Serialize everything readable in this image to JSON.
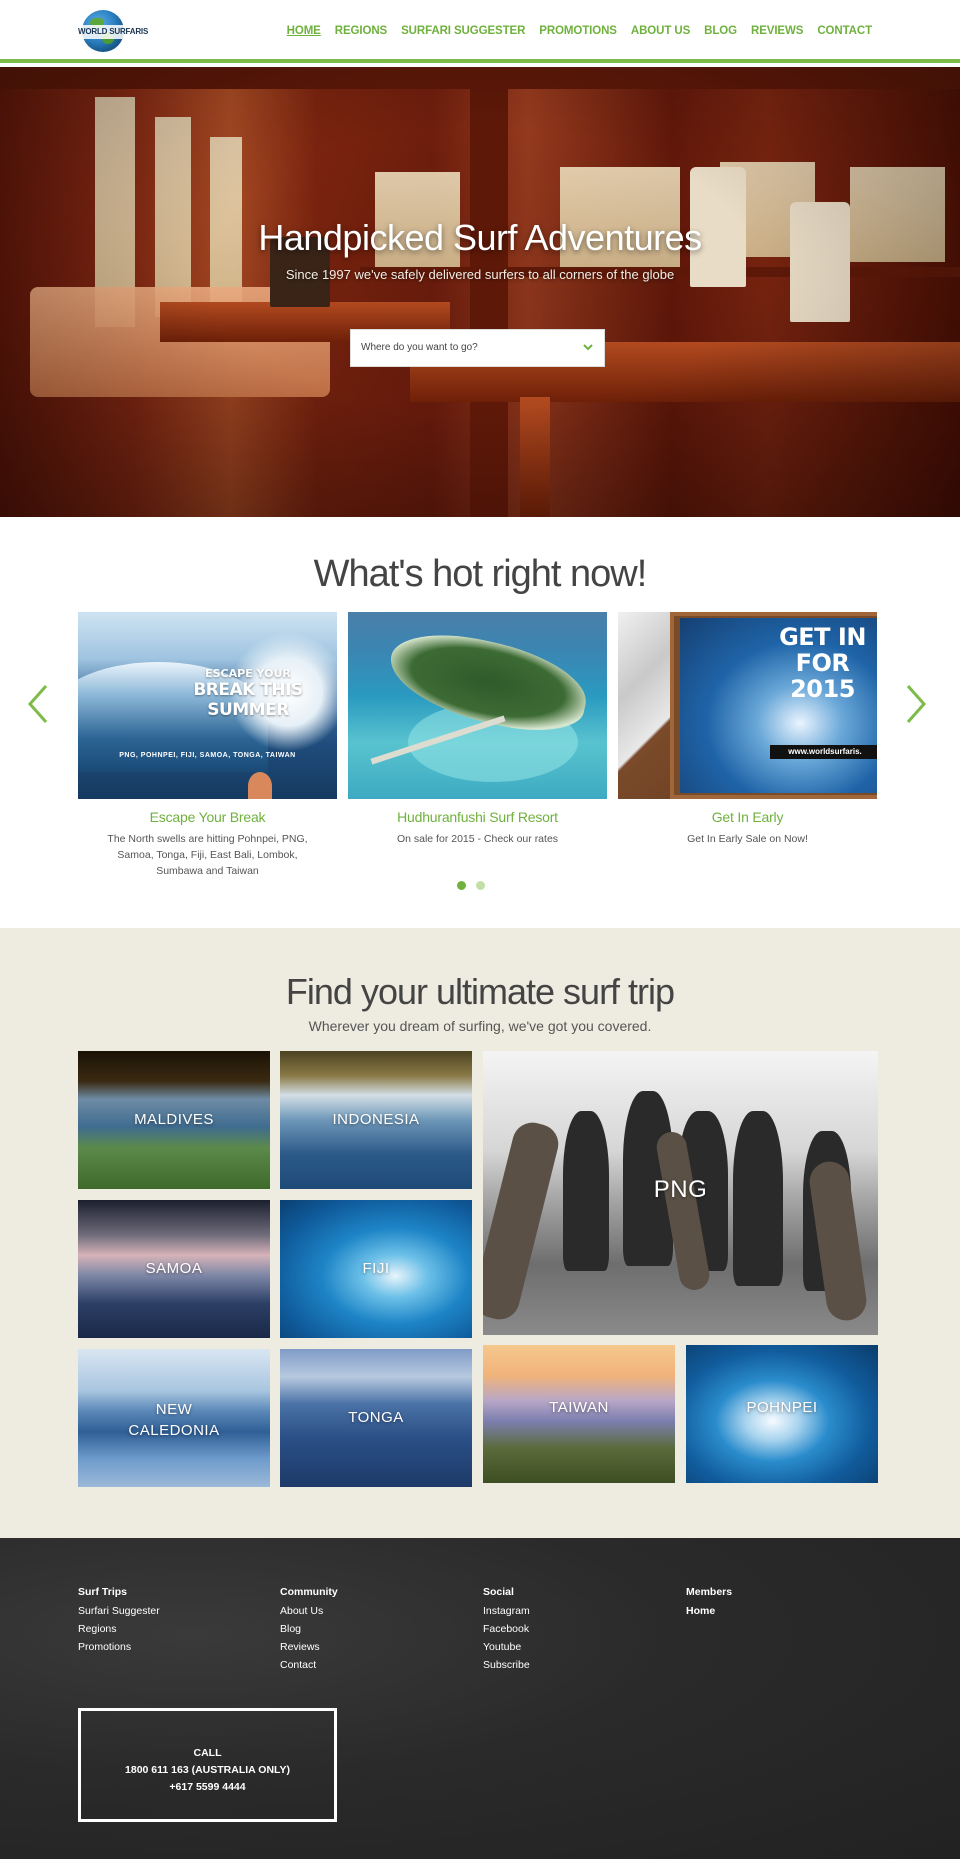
{
  "header": {
    "logo_text": "WORLD SURFARIS",
    "nav": [
      {
        "label": "HOME",
        "active": true
      },
      {
        "label": "REGIONS"
      },
      {
        "label": "SURFARI SUGGESTER"
      },
      {
        "label": "PROMOTIONS"
      },
      {
        "label": "ABOUT US"
      },
      {
        "label": "BLOG"
      },
      {
        "label": "REVIEWS"
      },
      {
        "label": "CONTACT"
      }
    ]
  },
  "hero": {
    "title": "Handpicked Surf Adventures",
    "subtitle": "Since 1997 we've safely delivered surfers to all corners of the globe",
    "select_placeholder": "Where do you want to go?"
  },
  "hot": {
    "title": "What's hot right now!",
    "cards": [
      {
        "title": "Escape Your Break",
        "desc": "The North swells are hitting Pohnpei, PNG, Samoa, Tonga, Fiji, East Bali, Lombok, Sumbawa and Taiwan",
        "image_line1": "ESCAPE YOUR",
        "image_line2": "BREAK THIS",
        "image_line3": "SUMMER",
        "image_caption": "PNG, POHNPEI, FIJI, SAMOA, TONGA, TAIWAN"
      },
      {
        "title": "Hudhuranfushi Surf Resort",
        "desc": "On sale for 2015 - Check our rates"
      },
      {
        "title": "Get In Early",
        "desc": "Get In Early Sale on Now!",
        "image_line1": "GET IN",
        "image_line2": "FOR 2015",
        "image_url": "www.worldsurfaris."
      }
    ],
    "dots": 2,
    "active_dot": 0
  },
  "find": {
    "title": "Find your ultimate surf trip",
    "subtitle": "Wherever you dream of surfing, we've got you covered.",
    "regions": [
      "MALDIVES",
      "INDONESIA",
      "PNG",
      "SAMOA",
      "FIJI",
      "NEW CALEDONIA",
      "TONGA",
      "TAIWAN",
      "POHNPEI"
    ]
  },
  "footer": {
    "cols": [
      {
        "heading": "Surf Trips",
        "links": [
          "Surfari Suggester",
          "Regions",
          "Promotions"
        ]
      },
      {
        "heading": "Community",
        "links": [
          "About Us",
          "Blog",
          "Reviews",
          "Contact"
        ]
      },
      {
        "heading": "Social",
        "links": [
          "Instagram",
          "Facebook",
          "Youtube",
          "Subscribe"
        ]
      },
      {
        "heading": "Members",
        "links": [
          "Home"
        ]
      }
    ],
    "call": {
      "label": "CALL",
      "line1": "1800 611 163 (AUSTRALIA ONLY)",
      "line2": "+617 5599 4444"
    }
  },
  "colors": {
    "accent": "#6fb13d",
    "find_bg": "#eeece0",
    "footer_bg": "#2a2a2a"
  }
}
